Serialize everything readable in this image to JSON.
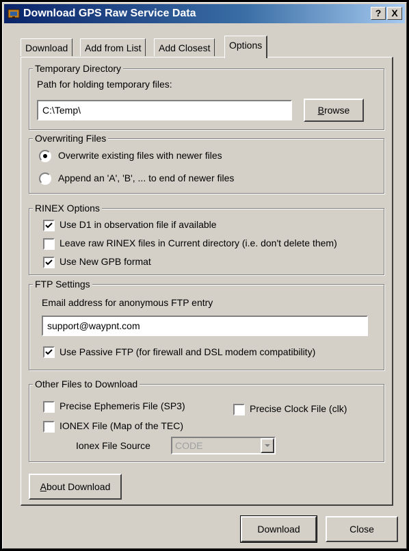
{
  "window": {
    "title": "Download GPS Raw Service Data",
    "help_label": "?",
    "close_label": "X"
  },
  "tabs": [
    {
      "label": "Download"
    },
    {
      "label": "Add from List"
    },
    {
      "label": "Add Closest"
    },
    {
      "label": "Options",
      "active": true
    }
  ],
  "temp_dir": {
    "legend": "Temporary Directory",
    "label": "Path for holding temporary files:",
    "value": "C:\\Temp\\",
    "browse_first": "B",
    "browse_rest": "rowse"
  },
  "overwrite": {
    "legend": "Overwriting Files",
    "options": [
      {
        "label": "Overwrite existing files with newer files",
        "selected": true
      },
      {
        "label": "Append an 'A', 'B', ... to end of newer files",
        "selected": false
      }
    ]
  },
  "rinex": {
    "legend": "RINEX Options",
    "options": [
      {
        "label": "Use D1 in observation file if available",
        "checked": true
      },
      {
        "label": "Leave raw RINEX files in Current directory (i.e. don't delete them)",
        "checked": false
      },
      {
        "label": "Use New GPB format",
        "checked": true
      }
    ]
  },
  "ftp": {
    "legend": "FTP Settings",
    "email_label": "Email address for anonymous FTP entry",
    "email_value": "support@waypnt.com",
    "passive_label": "Use Passive FTP (for firewall and DSL modem compatibility)",
    "passive_checked": true
  },
  "other_files": {
    "legend": "Other Files to Download",
    "sp3_label": "Precise Ephemeris File (SP3)",
    "sp3_checked": false,
    "clk_label": "Precise Clock File (clk)",
    "clk_checked": false,
    "ionex_label": "IONEX File (Map of the TEC)",
    "ionex_checked": false,
    "ionex_source_label": "Ionex File Source",
    "ionex_source_value": "CODE"
  },
  "about_first": "A",
  "about_rest": "bout Download",
  "footer": {
    "download_label": "Download",
    "close_label": "Close"
  }
}
